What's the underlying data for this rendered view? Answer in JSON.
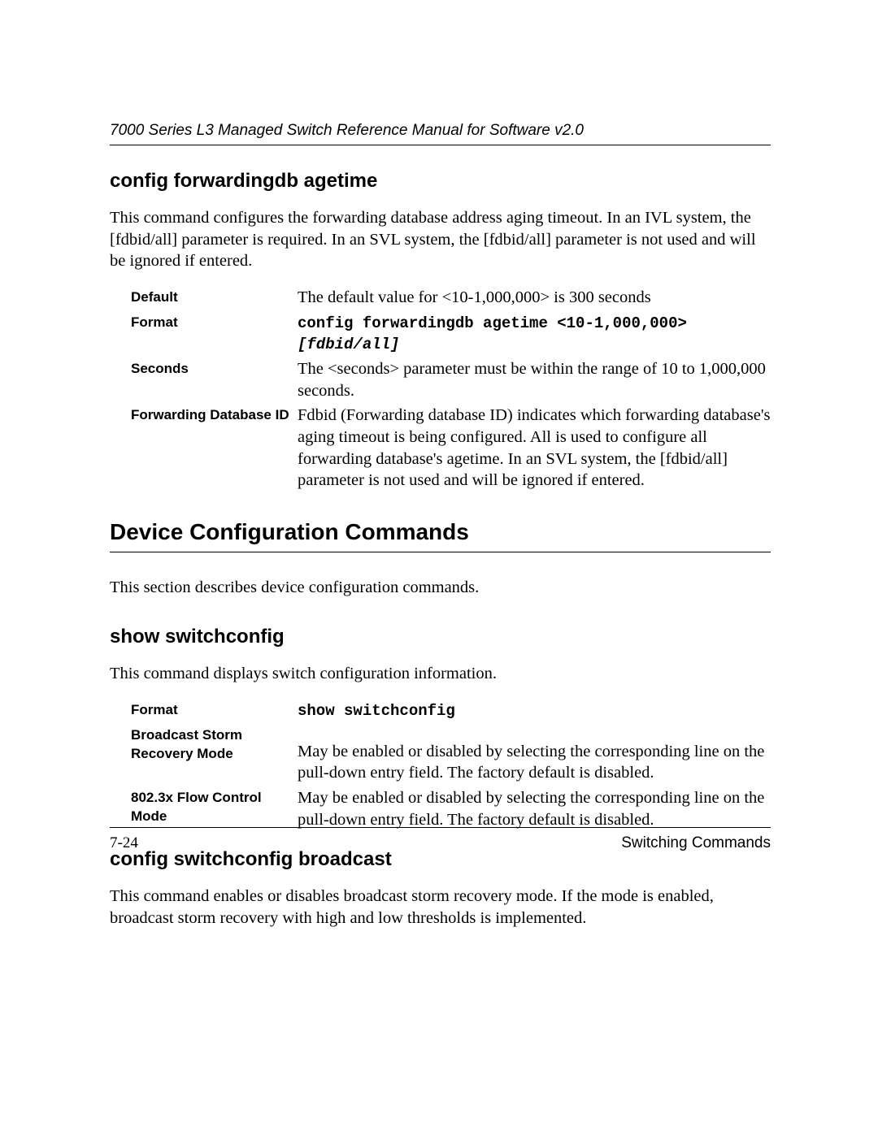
{
  "header": {
    "title": "7000 Series L3 Managed Switch Reference Manual for Software v2.0"
  },
  "sec1": {
    "heading": "config forwardingdb agetime",
    "body": "This command configures the forwarding database address aging timeout. In an IVL system, the [fdbid/all] parameter is required. In an SVL system, the [fdbid/all] parameter is not used and will be ignored if entered.",
    "rows": {
      "default": {
        "label": "Default",
        "value": "The default value for <10-1,000,000> is 300 seconds"
      },
      "format": {
        "label": "Format",
        "value_line1": "config forwardingdb agetime <10-1,000,000>",
        "value_line2": "[fdbid/all]"
      },
      "seconds": {
        "label": "Seconds",
        "value": "The <seconds> parameter must be within the range of 10 to 1,000,000 seconds."
      },
      "fdbid": {
        "label": "Forwarding Database ID",
        "value": "Fdbid (Forwarding database ID) indicates which forwarding database's aging timeout is being configured. All is used to configure all forwarding database's agetime. In an SVL system, the [fdbid/all] parameter is not used and will be ignored if entered."
      }
    }
  },
  "sec2": {
    "heading": "Device Configuration Commands",
    "body": "This section describes device configuration commands."
  },
  "sec3": {
    "heading": "show switchconfig",
    "body": "This command displays switch configuration information.",
    "rows": {
      "format": {
        "label": "Format",
        "value": "show switchconfig"
      },
      "bsrm": {
        "label_line1": "Broadcast Storm",
        "label_line2": "Recovery Mode",
        "value": "May be enabled or disabled by selecting the corresponding line on the pull-down entry field. The factory default is disabled."
      },
      "flow": {
        "label": "802.3x Flow Control Mode",
        "value": "May be enabled or disabled by selecting the corresponding line on the pull-down entry field. The factory default is disabled."
      }
    }
  },
  "sec4": {
    "heading": "config switchconfig broadcast",
    "body": "This command enables or disables broadcast storm recovery mode. If the mode is enabled, broadcast storm recovery with high and low thresholds is implemented."
  },
  "footer": {
    "page": "7-24",
    "section": "Switching Commands"
  }
}
